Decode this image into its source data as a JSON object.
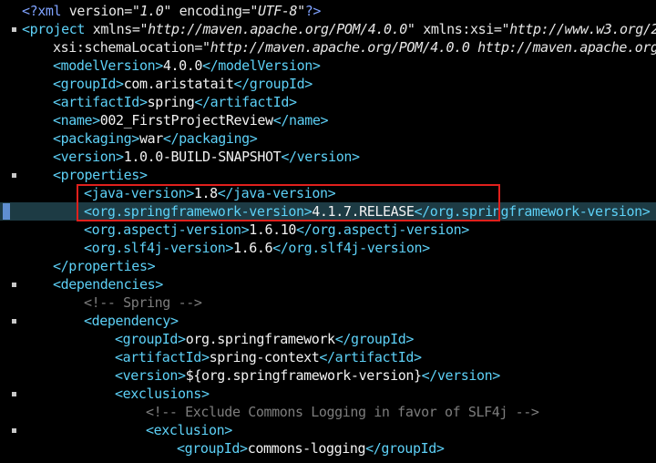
{
  "editor": {
    "lines": [
      {
        "indent": 0,
        "fold": false,
        "hl": false,
        "tokens": [
          {
            "t": "pi",
            "v": "<?xml "
          },
          {
            "t": "attr",
            "v": "version="
          },
          {
            "t": "str",
            "v": "\"1.0\""
          },
          {
            "t": "attr",
            "v": " encoding="
          },
          {
            "t": "str",
            "v": "\"UTF-8\""
          },
          {
            "t": "pi",
            "v": "?>"
          }
        ]
      },
      {
        "indent": 0,
        "fold": true,
        "hl": false,
        "tokens": [
          {
            "t": "tag",
            "v": "<project "
          },
          {
            "t": "attr",
            "v": "xmlns="
          },
          {
            "t": "str",
            "v": "\"http://maven.apache.org/POM/4.0.0\""
          },
          {
            "t": "attr",
            "v": " xmlns:xsi="
          },
          {
            "t": "str",
            "v": "\"http://www.w3.org/2"
          }
        ]
      },
      {
        "indent": 1,
        "fold": false,
        "hl": false,
        "tokens": [
          {
            "t": "attr",
            "v": "xsi:schemaLocation="
          },
          {
            "t": "str",
            "v": "\"http://maven.apache.org/POM/4.0.0 http://maven.apache.org/"
          }
        ]
      },
      {
        "indent": 1,
        "fold": false,
        "hl": false,
        "tokens": [
          {
            "t": "tag",
            "v": "<modelVersion>"
          },
          {
            "t": "text",
            "v": "4.0.0"
          },
          {
            "t": "tag",
            "v": "</modelVersion>"
          }
        ]
      },
      {
        "indent": 1,
        "fold": false,
        "hl": false,
        "tokens": [
          {
            "t": "tag",
            "v": "<groupId>"
          },
          {
            "t": "text",
            "v": "com.aristatait"
          },
          {
            "t": "tag",
            "v": "</groupId>"
          }
        ]
      },
      {
        "indent": 1,
        "fold": false,
        "hl": false,
        "tokens": [
          {
            "t": "tag",
            "v": "<artifactId>"
          },
          {
            "t": "text",
            "v": "spring"
          },
          {
            "t": "tag",
            "v": "</artifactId>"
          }
        ]
      },
      {
        "indent": 1,
        "fold": false,
        "hl": false,
        "tokens": [
          {
            "t": "tag",
            "v": "<name>"
          },
          {
            "t": "text",
            "v": "002_FirstProjectReview"
          },
          {
            "t": "tag",
            "v": "</name>"
          }
        ]
      },
      {
        "indent": 1,
        "fold": false,
        "hl": false,
        "tokens": [
          {
            "t": "tag",
            "v": "<packaging>"
          },
          {
            "t": "text",
            "v": "war"
          },
          {
            "t": "tag",
            "v": "</packaging>"
          }
        ]
      },
      {
        "indent": 1,
        "fold": false,
        "hl": false,
        "tokens": [
          {
            "t": "tag",
            "v": "<version>"
          },
          {
            "t": "text",
            "v": "1.0.0-BUILD-SNAPSHOT"
          },
          {
            "t": "tag",
            "v": "</version>"
          }
        ]
      },
      {
        "indent": 1,
        "fold": true,
        "hl": false,
        "tokens": [
          {
            "t": "tag",
            "v": "<properties>"
          }
        ]
      },
      {
        "indent": 2,
        "fold": false,
        "hl": false,
        "tokens": [
          {
            "t": "tag",
            "v": "<java-version>"
          },
          {
            "t": "text",
            "v": "1.8"
          },
          {
            "t": "tag",
            "v": "</java-version>"
          }
        ]
      },
      {
        "indent": 2,
        "fold": false,
        "hl": true,
        "tokens": [
          {
            "t": "tag",
            "v": "<org.springframework-version>"
          },
          {
            "t": "text",
            "v": "4.1.7.RELEASE"
          },
          {
            "t": "tag",
            "v": "</org.springframework-version>"
          }
        ]
      },
      {
        "indent": 2,
        "fold": false,
        "hl": false,
        "tokens": [
          {
            "t": "tag",
            "v": "<org.aspectj-version>"
          },
          {
            "t": "text",
            "v": "1.6.10"
          },
          {
            "t": "tag",
            "v": "</org.aspectj-version>"
          }
        ]
      },
      {
        "indent": 2,
        "fold": false,
        "hl": false,
        "tokens": [
          {
            "t": "tag",
            "v": "<org.slf4j-version>"
          },
          {
            "t": "text",
            "v": "1.6.6"
          },
          {
            "t": "tag",
            "v": "</org.slf4j-version>"
          }
        ]
      },
      {
        "indent": 1,
        "fold": false,
        "hl": false,
        "tokens": [
          {
            "t": "tag",
            "v": "</properties>"
          }
        ]
      },
      {
        "indent": 1,
        "fold": true,
        "hl": false,
        "tokens": [
          {
            "t": "tag",
            "v": "<dependencies>"
          }
        ]
      },
      {
        "indent": 2,
        "fold": false,
        "hl": false,
        "tokens": [
          {
            "t": "comment",
            "v": "<!-- Spring -->"
          }
        ]
      },
      {
        "indent": 2,
        "fold": true,
        "hl": false,
        "tokens": [
          {
            "t": "tag",
            "v": "<dependency>"
          }
        ]
      },
      {
        "indent": 3,
        "fold": false,
        "hl": false,
        "tokens": [
          {
            "t": "tag",
            "v": "<groupId>"
          },
          {
            "t": "text",
            "v": "org.springframework"
          },
          {
            "t": "tag",
            "v": "</groupId>"
          }
        ]
      },
      {
        "indent": 3,
        "fold": false,
        "hl": false,
        "tokens": [
          {
            "t": "tag",
            "v": "<artifactId>"
          },
          {
            "t": "text",
            "v": "spring-context"
          },
          {
            "t": "tag",
            "v": "</artifactId>"
          }
        ]
      },
      {
        "indent": 3,
        "fold": false,
        "hl": false,
        "tokens": [
          {
            "t": "tag",
            "v": "<version>"
          },
          {
            "t": "text",
            "v": "${org.springframework-version}"
          },
          {
            "t": "tag",
            "v": "</version>"
          }
        ]
      },
      {
        "indent": 3,
        "fold": true,
        "hl": false,
        "tokens": [
          {
            "t": "tag",
            "v": "<exclusions>"
          }
        ]
      },
      {
        "indent": 4,
        "fold": false,
        "hl": false,
        "tokens": [
          {
            "t": "comment",
            "v": "<!-- Exclude Commons Logging in favor of SLF4j -->"
          }
        ]
      },
      {
        "indent": 4,
        "fold": true,
        "hl": false,
        "tokens": [
          {
            "t": "tag",
            "v": "<exclusion>"
          }
        ]
      },
      {
        "indent": 5,
        "fold": false,
        "hl": false,
        "tokens": [
          {
            "t": "tag",
            "v": "<groupId>"
          },
          {
            "t": "text",
            "v": "commons-logging"
          },
          {
            "t": "tag",
            "v": "</groupId>"
          }
        ]
      }
    ]
  }
}
